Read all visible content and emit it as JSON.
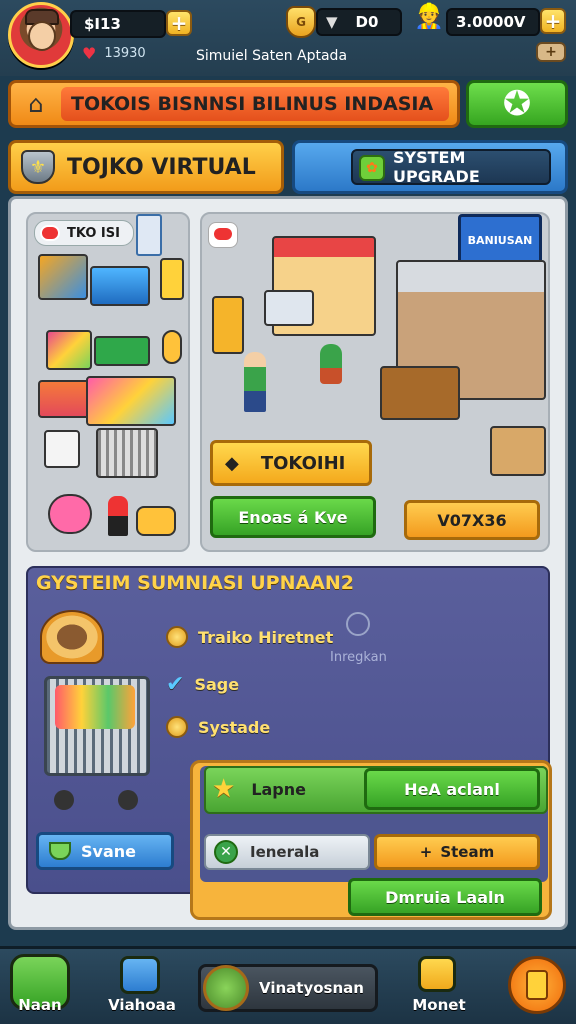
{
  "hud": {
    "money": "$I13",
    "gems": "D0",
    "coins": "3.0000V",
    "sub_value": "13930",
    "game_title": "Simuiel Saten Aptada"
  },
  "banner": {
    "title": "TOKOIS BISNNSI BILINUS INDASIA"
  },
  "tabs": {
    "toko": "TOJKO VIRTUAL",
    "upgrade": "SYSTEM UPGRADE"
  },
  "store": {
    "mini_label": "TKO ISI",
    "sign": "BANIUSAN",
    "toko_button": "TOKOIHI",
    "green_button": "Enoas á Kve",
    "orange_button": "V07X36"
  },
  "simulation": {
    "title": "GYSTEIM SUMNIASI UPNAAN2",
    "items": [
      "Traiko Hiretnet",
      "Sage",
      "Systade"
    ],
    "hint": "Inregkan",
    "svane_button": "Svane",
    "row1_label": "Lapne",
    "row1_button": "HeA aclanl",
    "row2_label": "Ienerala",
    "row2_button": "Steam",
    "bottom_button": "Dmruia Laaln"
  },
  "nav": {
    "items": [
      "Naan",
      "Viahoaa",
      "Vinatyosnan",
      "Monet"
    ]
  },
  "colors": {
    "accent_green": "#36a325",
    "accent_orange": "#f39a1d",
    "accent_blue": "#2d7dd0",
    "panel_purple": "#4a4f8c"
  }
}
